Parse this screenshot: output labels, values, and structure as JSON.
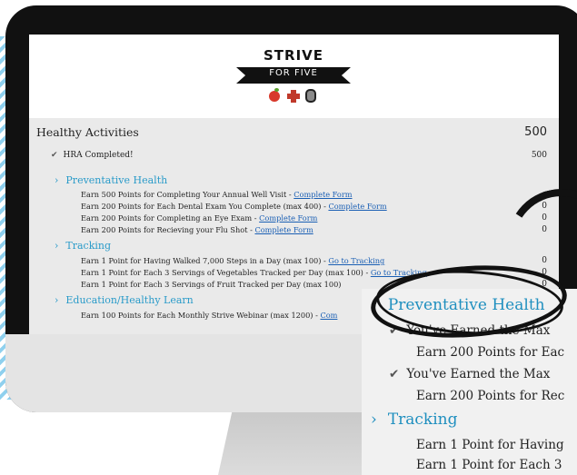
{
  "logo": {
    "title": "STRIVE",
    "subtitle": "FOR FIVE"
  },
  "healthy_activities": {
    "label": "Healthy Activities",
    "points": "500",
    "hra": {
      "label": "HRA Completed!",
      "points": "500"
    }
  },
  "sections": [
    {
      "title": "Preventative Health",
      "items": [
        {
          "text": "Earn 500 Points for Completing Your Annual Well Visit - ",
          "link": "Complete Form",
          "points": ""
        },
        {
          "text": "Earn 200 Points for Each Dental Exam You Complete (max 400) - ",
          "link": "Complete Form",
          "points": "0"
        },
        {
          "text": "Earn 200 Points for Completing an Eye Exam - ",
          "link": "Complete Form",
          "points": "0"
        },
        {
          "text": "Earn 200 Points for Recieving your Flu Shot - ",
          "link": "Complete Form",
          "points": "0"
        }
      ]
    },
    {
      "title": "Tracking",
      "items": [
        {
          "text": "Earn 1 Point for Having Walked 7,000 Steps in a Day (max 100) - ",
          "link": "Go to Tracking",
          "points": "0"
        },
        {
          "text": "Earn 1 Point for Each 3 Servings of Vegetables Tracked per Day (max 100) - ",
          "link": "Go to Tracking",
          "points": "0"
        },
        {
          "text": "Earn 1 Point for Each 3 Servings of Fruit Tracked per Day (max 100)",
          "link": "",
          "points": "0"
        }
      ]
    },
    {
      "title": "Education/Healthy Learn",
      "items": [
        {
          "text": "Earn 100 Points for Each Monthly Strive Webinar (max 1200) - ",
          "link": "Com",
          "points": ""
        }
      ]
    }
  ],
  "zoom": {
    "category1": "Preventative Health",
    "line1": "You've Earned the Max",
    "line2": "Earn 200 Points for Eac",
    "line3": "You've Earned the Max",
    "line4": "Earn 200 Points for Rec",
    "category2": "Tracking",
    "line5": "Earn 1 Point for Having",
    "line6": "Earn 1 Point for Each 3"
  }
}
